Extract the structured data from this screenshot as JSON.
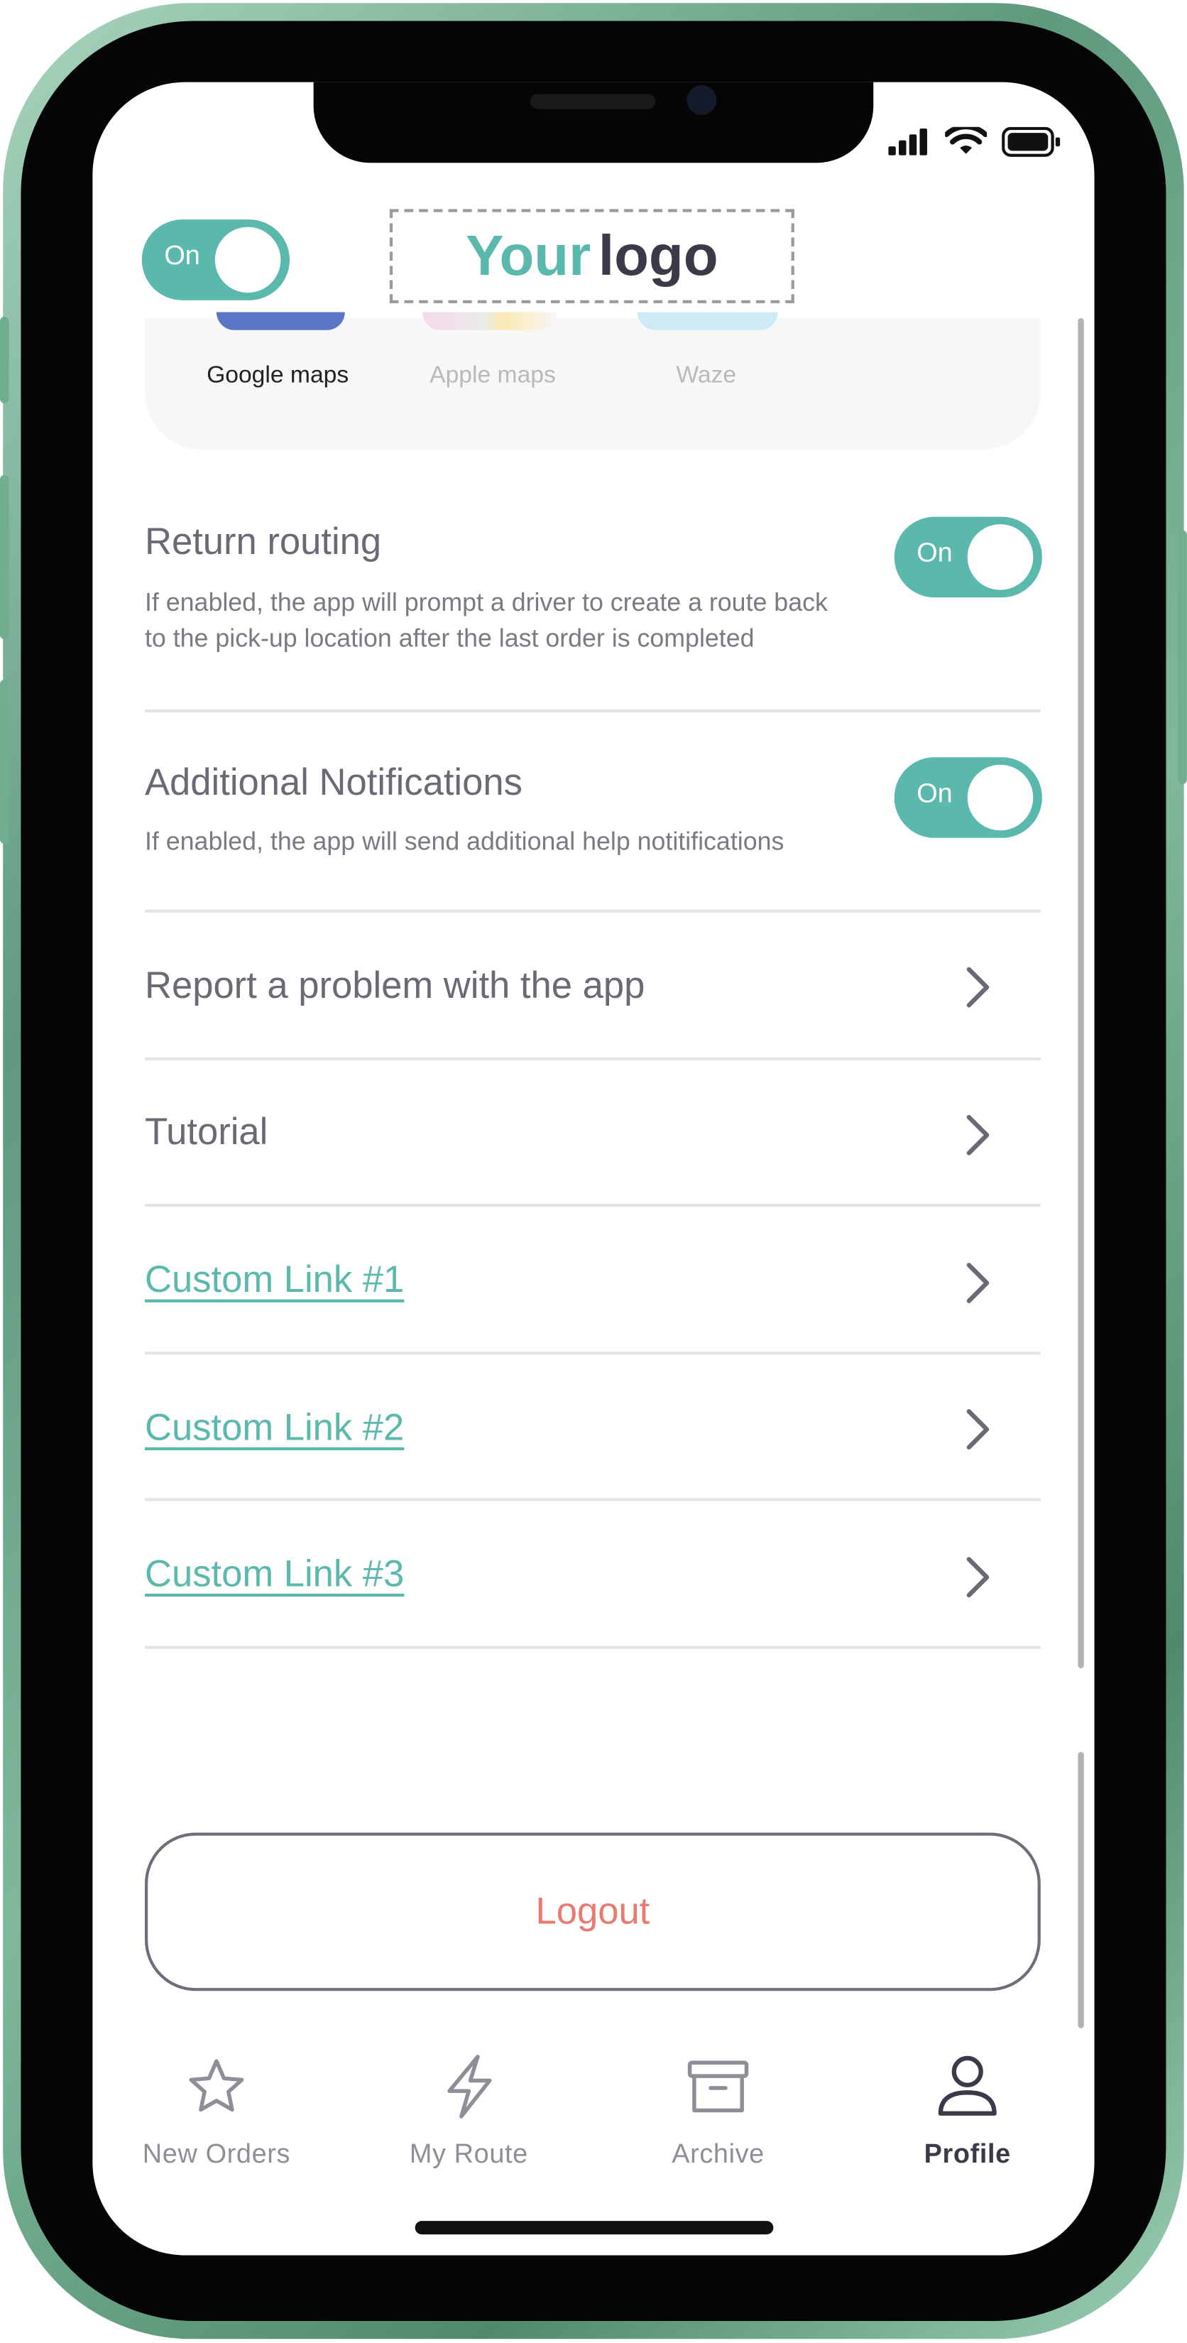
{
  "header": {
    "toggle_label": "On",
    "logo_part1": "Your",
    "logo_part2": "logo"
  },
  "maps": [
    {
      "label": "Google maps",
      "selected": true
    },
    {
      "label": "Apple maps",
      "selected": false
    },
    {
      "label": "Waze",
      "selected": false
    }
  ],
  "settings": {
    "return_routing": {
      "title": "Return routing",
      "description": "If enabled, the app will prompt a driver to create a route back to the pick-up location after the last order is completed",
      "toggle_label": "On"
    },
    "additional_notifications": {
      "title": "Additional Notifications",
      "description": "If enabled, the app will send additional help notitifications",
      "toggle_label": "On"
    }
  },
  "menu": [
    {
      "label": "Report a problem with the app"
    },
    {
      "label": "Tutorial"
    },
    {
      "label": "Custom Link #1"
    },
    {
      "label": "Custom Link #2"
    },
    {
      "label": "Custom Link #3"
    }
  ],
  "logout_label": "Logout",
  "tabs": [
    {
      "label": "New Orders",
      "icon": "star-icon"
    },
    {
      "label": "My Route",
      "icon": "lightning-icon"
    },
    {
      "label": "Archive",
      "icon": "archive-box-icon"
    },
    {
      "label": "Profile",
      "icon": "user-icon",
      "active": true
    }
  ],
  "colors": {
    "accent": "#5ab8ad",
    "text": "#6b6a74",
    "logout": "#e87a70",
    "dark": "#3b3a48"
  }
}
